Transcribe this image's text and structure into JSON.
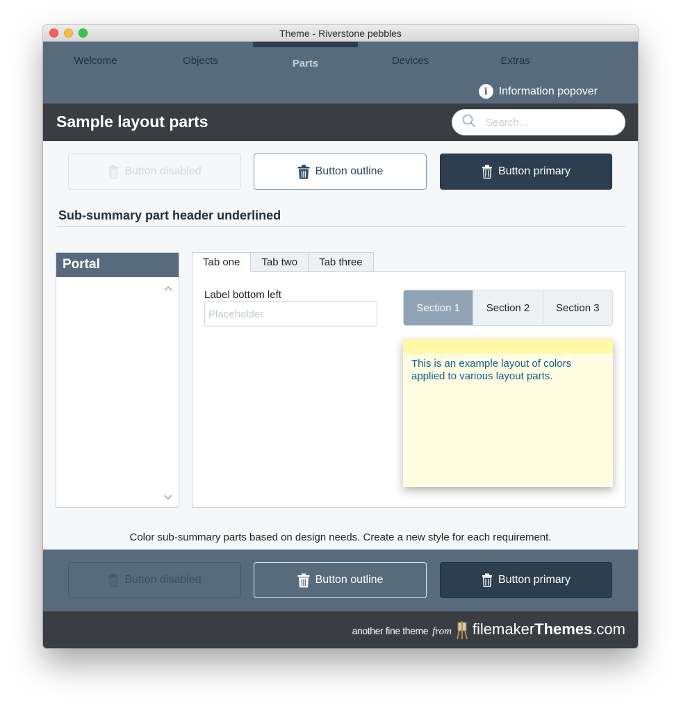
{
  "window": {
    "title": "Theme - Riverstone pebbles"
  },
  "nav": {
    "tabs": [
      {
        "label": "Welcome"
      },
      {
        "label": "Objects"
      },
      {
        "label": "Parts"
      },
      {
        "label": "Devices"
      },
      {
        "label": "Extras"
      }
    ],
    "active_tab": "Parts",
    "info_popover_label": "Information popover"
  },
  "header": {
    "title": "Sample layout parts",
    "search_placeholder": "Search..."
  },
  "top_buttons": {
    "disabled_label": "Button disabled",
    "outline_label": "Button outline",
    "primary_label": "Button primary"
  },
  "subsummary": {
    "header": "Sub-summary part header underlined"
  },
  "portal": {
    "title": "Portal"
  },
  "tabs": {
    "items": [
      {
        "label": "Tab one"
      },
      {
        "label": "Tab two"
      },
      {
        "label": "Tab three"
      }
    ],
    "active": "Tab one"
  },
  "field": {
    "label": "Label bottom left",
    "placeholder": "Placeholder",
    "value": ""
  },
  "segments": {
    "items": [
      {
        "label": "Section 1"
      },
      {
        "label": "Section 2"
      },
      {
        "label": "Section 3"
      }
    ],
    "active": "Section 1"
  },
  "note": {
    "text": "This is an example layout of colors applied to various layout parts."
  },
  "footer_caption": "Color sub-summary parts based on design needs. Create a new style for each requirement.",
  "bottom_buttons": {
    "disabled_label": "Button disabled",
    "outline_label": "Button outline",
    "primary_label": "Button primary"
  },
  "credit": {
    "prefix": "another fine theme",
    "from": "from",
    "brand_regular": "filemaker",
    "brand_bold": "Themes",
    "brand_suffix": ".com"
  },
  "colors": {
    "nav_bg": "#576b7d",
    "header_bg": "#3a3d41",
    "primary_button": "#2c3e4f",
    "segment_active": "#8fa3b5",
    "note_bg": "#fffde1",
    "note_text": "#0f5c8c"
  },
  "icons": {
    "button": "trash-icon",
    "search": "search-icon",
    "info": "info-icon",
    "portal_scroll_up": "chevron-up-icon",
    "portal_scroll_down": "chevron-down-icon",
    "credit_logo": "easel-icon"
  }
}
